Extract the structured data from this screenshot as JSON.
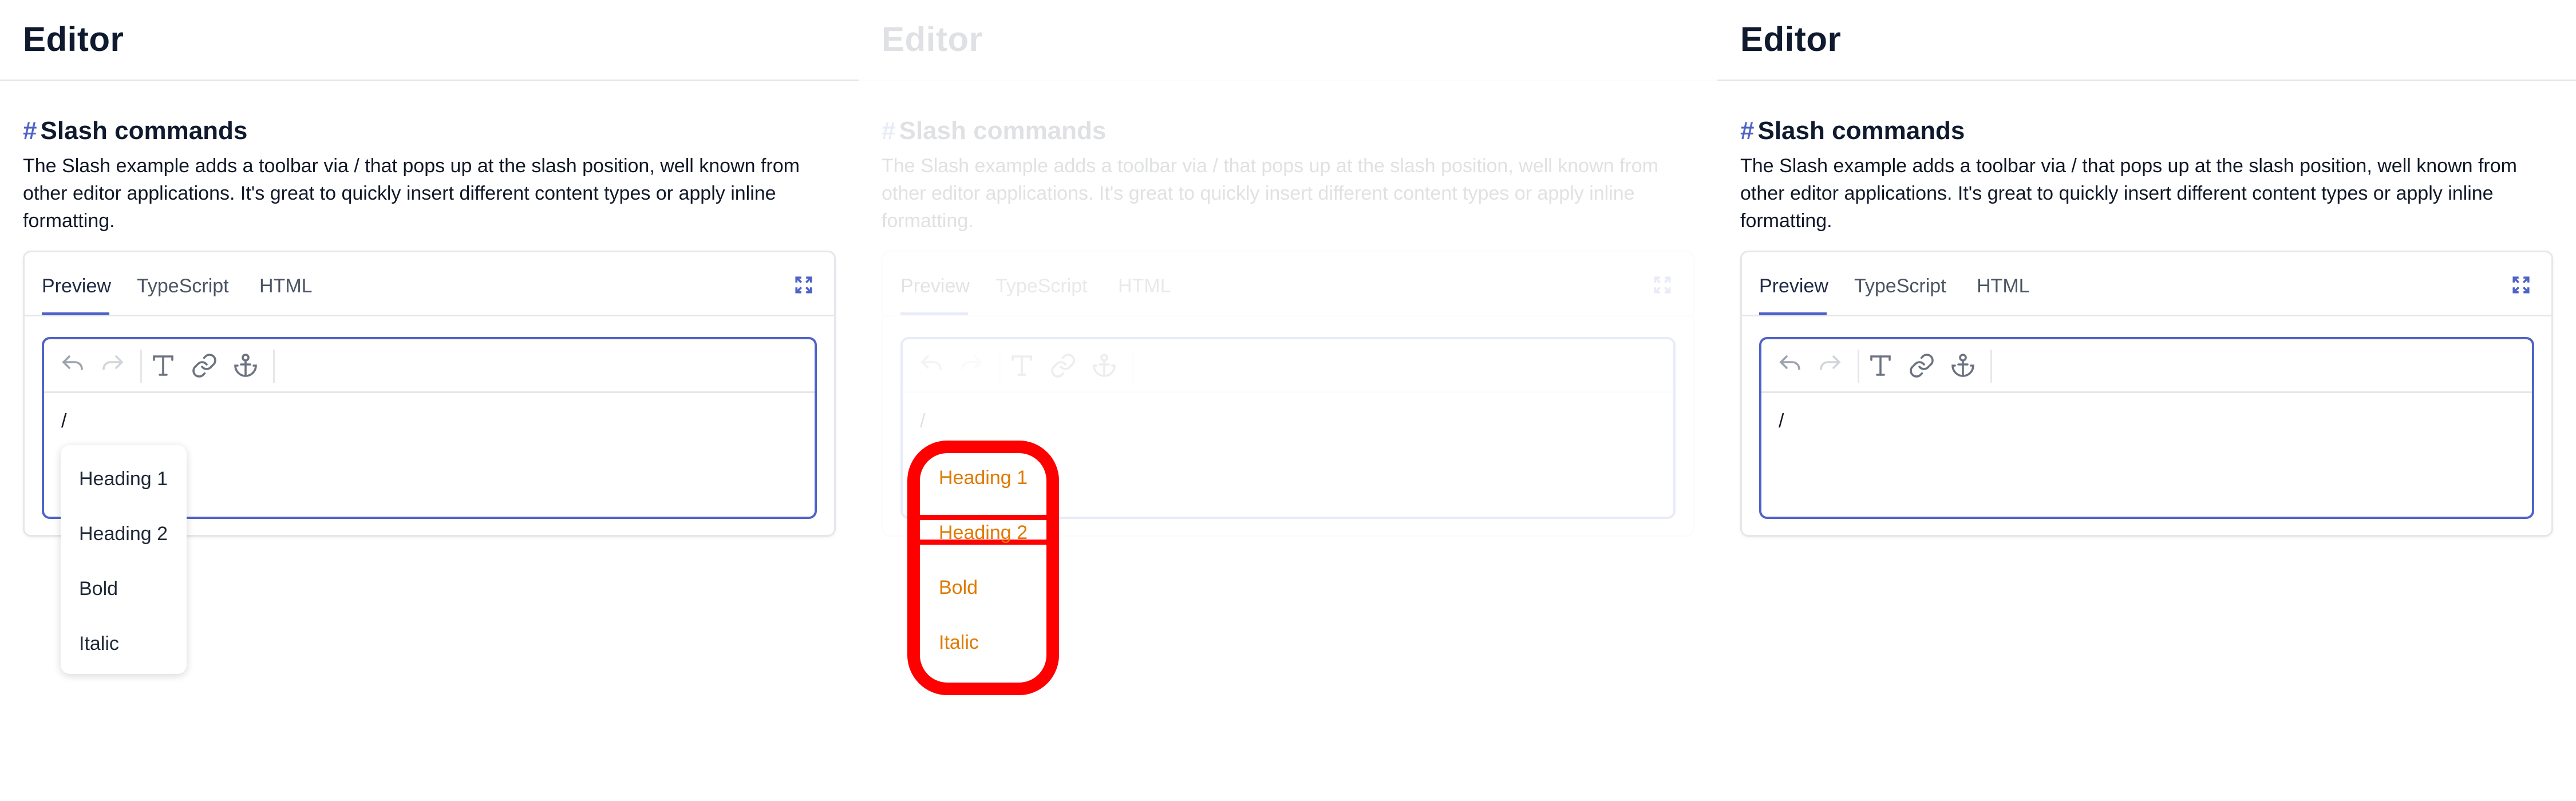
{
  "panels": [
    {
      "app_title": "Editor",
      "section": {
        "hash": "#",
        "title": "Slash commands"
      },
      "description": "The Slash example adds a toolbar via / that pops up at the slash position, well known from other editor applications. It's great to quickly insert different content types or apply inline formatting.",
      "tabs": [
        "Preview",
        "TypeScript",
        "HTML"
      ],
      "editor_text": "/",
      "menu": [
        "Heading 1",
        "Heading 2",
        "Bold",
        "Italic"
      ]
    },
    {
      "app_title": "Editor",
      "section": {
        "hash": "#",
        "title": "Slash commands"
      },
      "description": "The Slash example adds a toolbar via / that pops up at the slash position, well known from other editor applications. It's great to quickly insert different content types or apply inline formatting.",
      "tabs": [
        "Preview",
        "TypeScript",
        "HTML"
      ],
      "editor_text": "/",
      "menu": [
        "Heading 1",
        "Heading 2",
        "Bold",
        "Italic"
      ]
    },
    {
      "app_title": "Editor",
      "section": {
        "hash": "#",
        "title": "Slash commands"
      },
      "description": "The Slash example adds a toolbar via / that pops up at the slash position, well known from other editor applications. It's great to quickly insert different content types or apply inline formatting.",
      "tabs": [
        "Preview",
        "TypeScript",
        "HTML"
      ],
      "editor_text": "/"
    }
  ],
  "icons": {
    "undo": "undo-icon",
    "redo": "redo-icon",
    "text": "text-style-icon",
    "link": "link-icon",
    "anchor": "anchor-icon",
    "expand": "expand-icon"
  },
  "colors": {
    "accent": "#4f63c7",
    "highlight_outline": "#ff0000",
    "highlight_text": "#e07a00",
    "border": "#e5e7eb"
  }
}
